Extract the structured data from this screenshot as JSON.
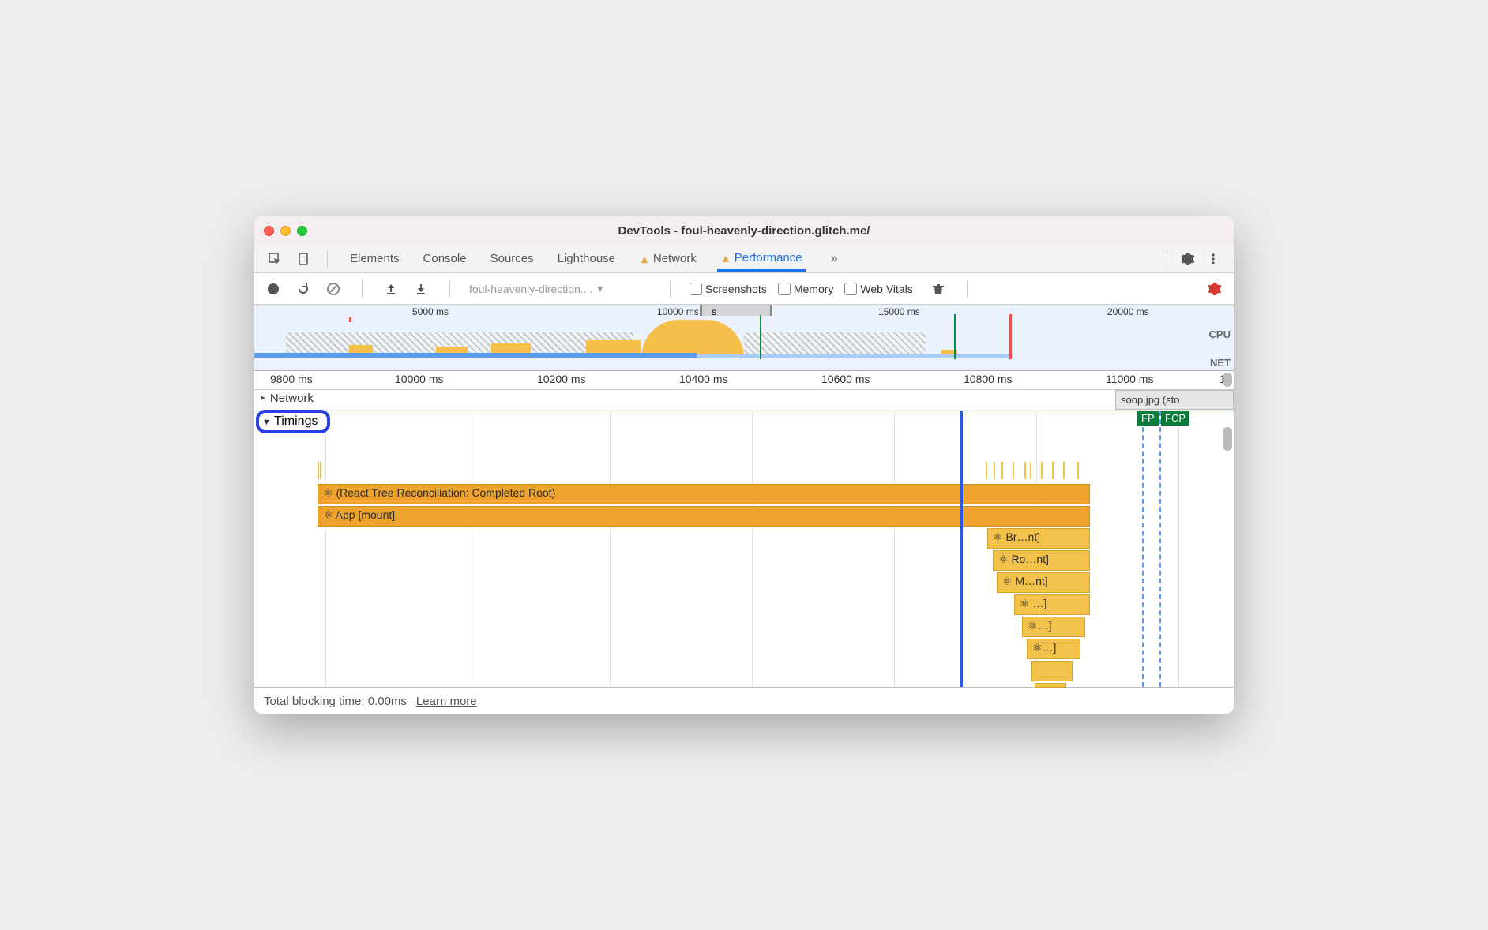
{
  "window": {
    "title": "DevTools - foul-heavenly-direction.glitch.me/"
  },
  "tabs": {
    "elements": "Elements",
    "console": "Console",
    "sources": "Sources",
    "lighthouse": "Lighthouse",
    "network": "Network",
    "performance": "Performance"
  },
  "toolbar": {
    "profile_select": "foul-heavenly-direction....",
    "screenshots": "Screenshots",
    "memory": "Memory",
    "webvitals": "Web Vitals"
  },
  "overview": {
    "ticks": [
      "5000 ms",
      "10000 ms",
      "15000 ms",
      "20000 ms"
    ],
    "cpu_label": "CPU",
    "net_label": "NET",
    "selector_letter": "s"
  },
  "ruler": {
    "ticks": [
      "9800 ms",
      "10000 ms",
      "10200 ms",
      "10400 ms",
      "10600 ms",
      "10800 ms",
      "11000 ms",
      "1"
    ]
  },
  "lanes": {
    "network": "Network",
    "timings": "Timings",
    "soop": "soop.jpg (sto"
  },
  "flame": {
    "row1": "⚛ (React Tree Reconciliation: Completed Root)",
    "row2": "⚛ App [mount]",
    "r3": "⚛ Br…nt]",
    "r4": "⚛ Ro…nt]",
    "r5": "⚛ M…nt]",
    "r6": "⚛ …]",
    "r7": "⚛…]",
    "r8": "⚛…]"
  },
  "markers": {
    "fp": "FP",
    "fcp": "FCP"
  },
  "bottom": {
    "tbt": "Total blocking time: 0.00ms",
    "learn": "Learn more"
  }
}
